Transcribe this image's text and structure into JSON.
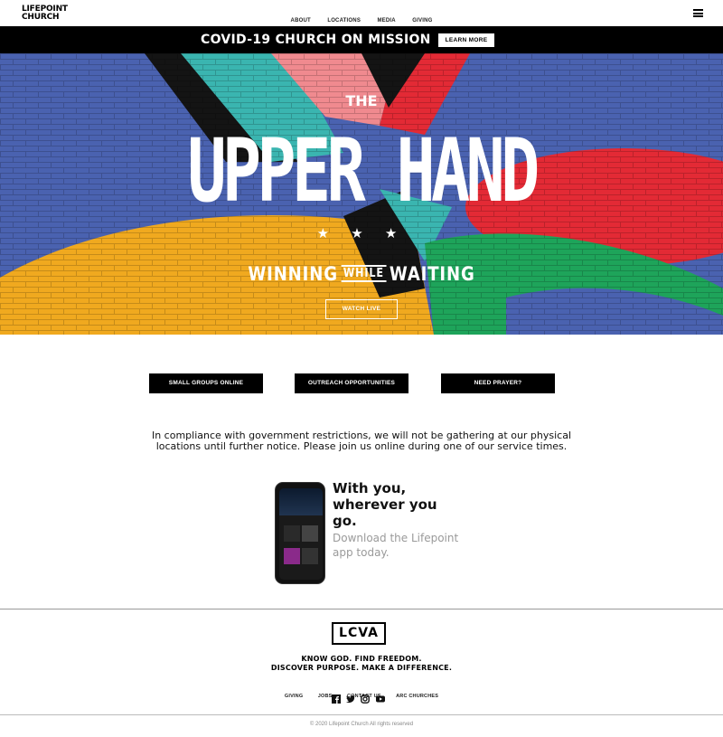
{
  "header": {
    "logo_line1": "LIFEPOINT",
    "logo_line2": "CHURCH",
    "nav": [
      "ABOUT",
      "LOCATIONS",
      "MEDIA",
      "GIVING"
    ],
    "menu_icon": "hamburger-icon"
  },
  "banner": {
    "title": "COVID-19 CHURCH ON MISSION",
    "button": "LEARN MORE"
  },
  "hero": {
    "the": "THE",
    "title": "UPPER HAND",
    "stars": "★ ★ ★",
    "sub_1": "WINNING",
    "sub_2": "WHILE",
    "sub_3": "WAITING",
    "button": "WATCH LIVE",
    "colors": {
      "blue": "#4a62b0",
      "red": "#e32a35",
      "yellow": "#f0a91f",
      "green": "#1ea45a",
      "pink": "#f08a8f",
      "teal": "#3ab5b0",
      "black": "#141414"
    }
  },
  "actions": [
    "SMALL GROUPS ONLINE",
    "OUTREACH OPPORTUNITIES",
    "NEED PRAYER?"
  ],
  "notice": "In compliance with government restrictions, we will not be gathering at our physical locations until further notice. Please join us online during one of our service times.",
  "promo": {
    "headline": "With you, wherever you go.",
    "subtext": "Download the Lifepoint app today."
  },
  "footer": {
    "logo": "LCVA",
    "tagline_1": "KNOW GOD. FIND FREEDOM.",
    "tagline_2": "DISCOVER PURPOSE. MAKE A DIFFERENCE.",
    "links": [
      "GIVING",
      "JOBS",
      "CONTACT US",
      "ARC CHURCHES"
    ],
    "social_icons": [
      "facebook-icon",
      "twitter-icon",
      "instagram-icon",
      "youtube-icon"
    ],
    "copyright": "© 2020 Lifepoint Church All rights reserved"
  }
}
